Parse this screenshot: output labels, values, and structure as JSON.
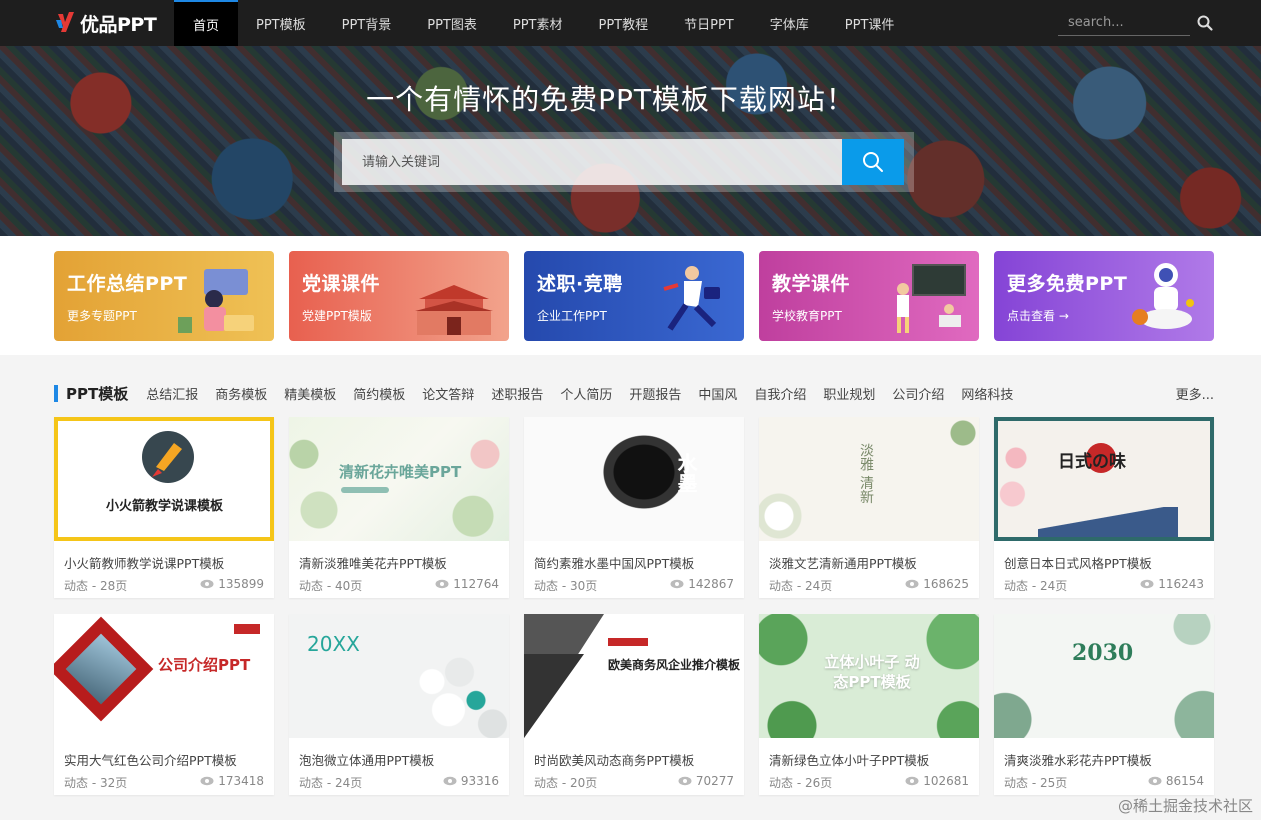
{
  "logo": {
    "text": "优品PPT"
  },
  "nav": {
    "items": [
      "首页",
      "PPT模板",
      "PPT背景",
      "PPT图表",
      "PPT素材",
      "PPT教程",
      "节日PPT",
      "字体库",
      "PPT课件"
    ],
    "search_placeholder": "search..."
  },
  "hero": {
    "title": "一个有情怀的免费PPT模板下载网站！",
    "search_placeholder": "请输入关键词"
  },
  "categories": [
    {
      "title": "工作总结PPT",
      "sub": "更多专题PPT",
      "color": "#e0a93a"
    },
    {
      "title": "党课课件",
      "sub": "党建PPT模版",
      "color": "#e9705f"
    },
    {
      "title": "述职·竞聘",
      "sub": "企业工作PPT",
      "color": "#2c55b8"
    },
    {
      "title": "教学课件",
      "sub": "学校教育PPT",
      "color": "#c84fa6"
    },
    {
      "title": "更多免费PPT",
      "sub": "点击查看 →",
      "color": "#8a4fd8"
    }
  ],
  "section": {
    "title": "PPT模板",
    "tags": [
      "总结汇报",
      "商务模板",
      "精美模板",
      "简约模板",
      "论文答辩",
      "述职报告",
      "个人简历",
      "开题报告",
      "中国风",
      "自我介绍",
      "职业规划",
      "公司介绍",
      "网络科技"
    ],
    "more": "更多..."
  },
  "cards": [
    {
      "title": "小火箭教师教学说课PPT模板",
      "meta": "动态 - 28页",
      "views": "135899",
      "thumb_text": "小火箭教学说课模板"
    },
    {
      "title": "清新淡雅唯美花卉PPT模板",
      "meta": "动态 - 40页",
      "views": "112764",
      "thumb_text": "清新花卉唯美PPT"
    },
    {
      "title": "简约素雅水墨中国风PPT模板",
      "meta": "动态 - 30页",
      "views": "142867",
      "thumb_text": "水墨"
    },
    {
      "title": "淡雅文艺清新通用PPT模板",
      "meta": "动态 - 24页",
      "views": "168625",
      "thumb_text": "淡雅 清新"
    },
    {
      "title": "创意日本日式风格PPT模板",
      "meta": "动态 - 24页",
      "views": "116243",
      "thumb_text": "日式の味"
    },
    {
      "title": "实用大气红色公司介绍PPT模板",
      "meta": "动态 - 32页",
      "views": "173418",
      "thumb_text": "公司介绍PPT"
    },
    {
      "title": "泡泡微立体通用PPT模板",
      "meta": "动态 - 24页",
      "views": "93316",
      "thumb_text": "20XX"
    },
    {
      "title": "时尚欧美风动态商务PPT模板",
      "meta": "动态 - 20页",
      "views": "70277",
      "thumb_text": "欧美商务风企业推介模板"
    },
    {
      "title": "清新绿色立体小叶子PPT模板",
      "meta": "动态 - 26页",
      "views": "102681",
      "thumb_text": "立体小叶子 动态PPT模板"
    },
    {
      "title": "清爽淡雅水彩花卉PPT模板",
      "meta": "动态 - 25页",
      "views": "86154",
      "thumb_text": "2030"
    }
  ],
  "watermark": "@稀土掘金技术社区"
}
